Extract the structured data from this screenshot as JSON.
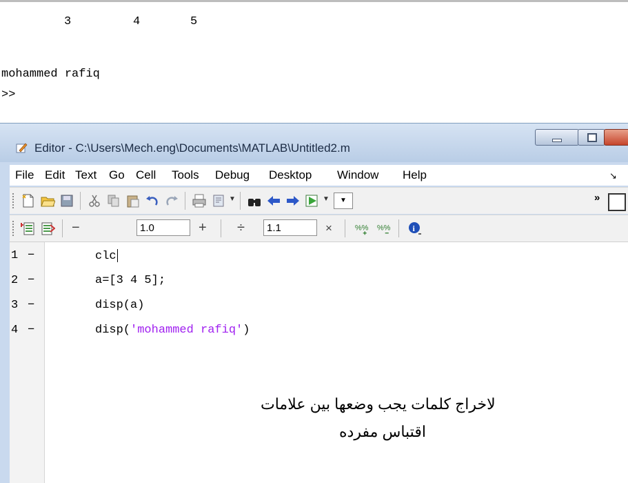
{
  "command_window": {
    "output_numbers": [
      "3",
      "4",
      "5"
    ],
    "output_text": "mohammed rafiq",
    "prompt": ">>"
  },
  "editor": {
    "title": "Editor - C:\\Users\\Mech.eng\\Documents\\MATLAB\\Untitled2.m",
    "menu": [
      "File",
      "Edit",
      "Text",
      "Go",
      "Cell",
      "Tools",
      "Debug",
      "Desktop",
      "Window",
      "Help"
    ],
    "cell_toolbar": {
      "minus": "−",
      "first_value": "1.0",
      "plus": "+",
      "divide": "÷",
      "second_value": "1.1",
      "times": "×"
    },
    "lines": [
      {
        "number": "1",
        "marker": "−",
        "code": "clc"
      },
      {
        "number": "2",
        "marker": "−",
        "code": "a=[3 4 5];"
      },
      {
        "number": "3",
        "marker": "−",
        "code": "disp(a)"
      },
      {
        "number": "4",
        "marker": "−",
        "code_prefix": "disp(",
        "code_string": "'mohammed rafiq'",
        "code_suffix": ")"
      }
    ]
  },
  "annotation": {
    "line1": "لاخراج كلمات يجب وضعها بين علامات",
    "line2": "اقتباس مفرده"
  },
  "colors": {
    "string": "#a020f0",
    "title_bar": "#c9d9ee",
    "close_button": "#c6452c"
  },
  "icons": [
    "new-file-icon",
    "open-folder-icon",
    "save-icon",
    "cut-icon",
    "copy-icon",
    "paste-icon",
    "undo-icon",
    "redo-icon",
    "print-icon",
    "find-files-icon",
    "binoculars-icon",
    "back-arrow-icon",
    "forward-arrow-icon",
    "run-icon",
    "info-icon"
  ]
}
